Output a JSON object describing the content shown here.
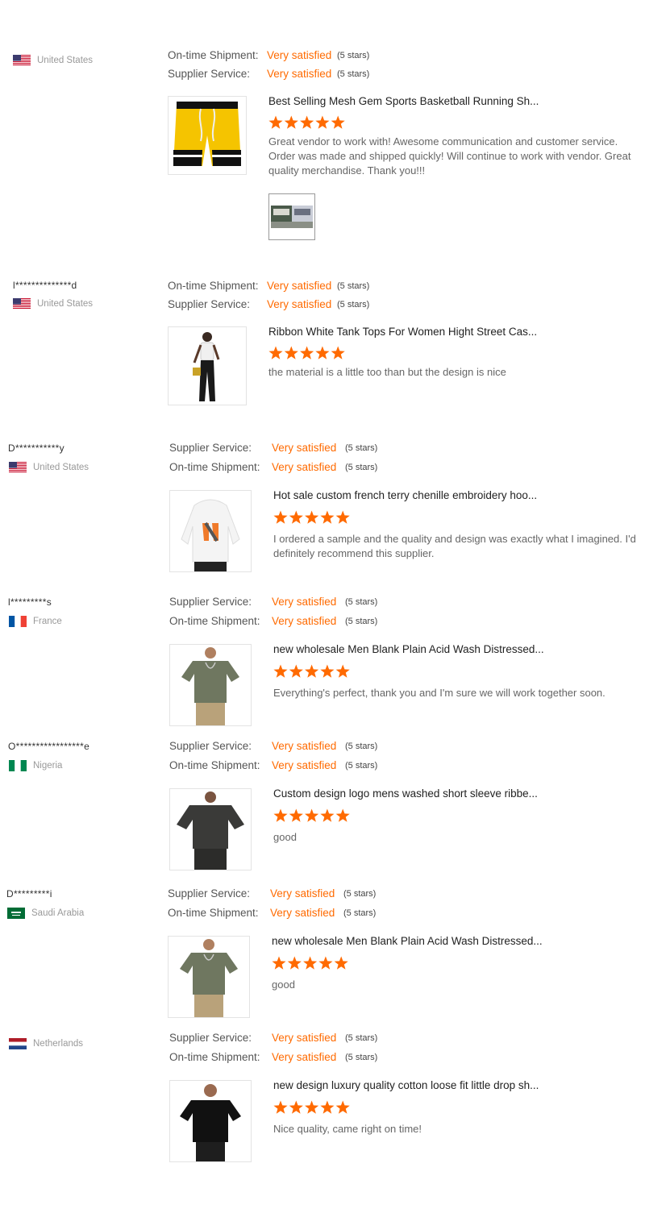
{
  "reviews": [
    {
      "user": "",
      "country": "United States",
      "flag": "us",
      "lines": [
        {
          "label": "On-time Shipment:",
          "value": "Very satisfied",
          "stars": "(5 stars)"
        },
        {
          "label": "Supplier Service:",
          "value": "Very satisfied",
          "stars": "(5 stars)"
        }
      ],
      "product_title": "Best Selling Mesh Gem Sports Basketball Running Sh...",
      "rating": 5,
      "comment": "Great vendor to work with! Awesome communication and customer service. Order was made and shipped quickly! Will continue to work with vendor. Great quality merchandise. Thank you!!!",
      "product_image": "yellow-shorts",
      "has_thumb": true
    },
    {
      "user": "l**************d",
      "country": "United States",
      "flag": "us",
      "lines": [
        {
          "label": "On-time Shipment:",
          "value": "Very satisfied",
          "stars": "(5 stars)"
        },
        {
          "label": "Supplier Service:",
          "value": "Very satisfied",
          "stars": "(5 stars)"
        }
      ],
      "product_title": "Ribbon White Tank Tops For Women Hight Street Cas...",
      "rating": 5,
      "comment": "the material is a little too than but the design is nice",
      "product_image": "woman-outfit"
    },
    {
      "user": "D***********y",
      "country": "United States",
      "flag": "us",
      "lines": [
        {
          "label": "Supplier Service:",
          "value": "Very satisfied",
          "stars": "(5 stars)"
        },
        {
          "label": "On-time Shipment:",
          "value": "Very satisfied",
          "stars": "(5 stars)"
        }
      ],
      "product_title": "Hot sale custom french terry chenille embroidery hoo...",
      "rating": 5,
      "comment": "I ordered a sample and the quality and design was exactly what I imagined. I'd definitely recommend this supplier.",
      "product_image": "white-hoodie"
    },
    {
      "user": "l*********s",
      "country": "France",
      "flag": "fr",
      "lines": [
        {
          "label": "Supplier Service:",
          "value": "Very satisfied",
          "stars": "(5 stars)"
        },
        {
          "label": "On-time Shipment:",
          "value": "Very satisfied",
          "stars": "(5 stars)"
        }
      ],
      "product_title": "new wholesale Men Blank Plain Acid Wash Distressed...",
      "rating": 5,
      "comment": "Everything's perfect, thank you and I'm sure we will work together soon.",
      "product_image": "olive-tee"
    },
    {
      "user": "O*****************e",
      "country": "Nigeria",
      "flag": "ng",
      "lines": [
        {
          "label": "Supplier Service:",
          "value": "Very satisfied",
          "stars": "(5 stars)"
        },
        {
          "label": "On-time Shipment:",
          "value": "Very satisfied",
          "stars": "(5 stars)"
        }
      ],
      "product_title": "Custom design logo mens washed short sleeve ribbe...",
      "rating": 5,
      "comment": "good",
      "product_image": "charcoal-tee"
    },
    {
      "user": "D*********i",
      "country": "Saudi Arabia",
      "flag": "sa",
      "lines": [
        {
          "label": "Supplier Service:",
          "value": "Very satisfied",
          "stars": "(5 stars)"
        },
        {
          "label": "On-time Shipment:",
          "value": "Very satisfied",
          "stars": "(5 stars)"
        }
      ],
      "product_title": "new wholesale Men Blank Plain Acid Wash Distressed...",
      "rating": 5,
      "comment": "good",
      "product_image": "olive-tee"
    },
    {
      "user": "",
      "country": "Netherlands",
      "flag": "nl",
      "lines": [
        {
          "label": "Supplier Service:",
          "value": "Very satisfied",
          "stars": "(5 stars)"
        },
        {
          "label": "On-time Shipment:",
          "value": "Very satisfied",
          "stars": "(5 stars)"
        }
      ],
      "product_title": "new design luxury quality cotton loose fit little drop sh...",
      "rating": 5,
      "comment": "Nice quality, came right on time!",
      "product_image": "black-tee"
    }
  ],
  "colors": {
    "accent": "#ff6a00",
    "label": "#555555",
    "muted": "#999999"
  }
}
